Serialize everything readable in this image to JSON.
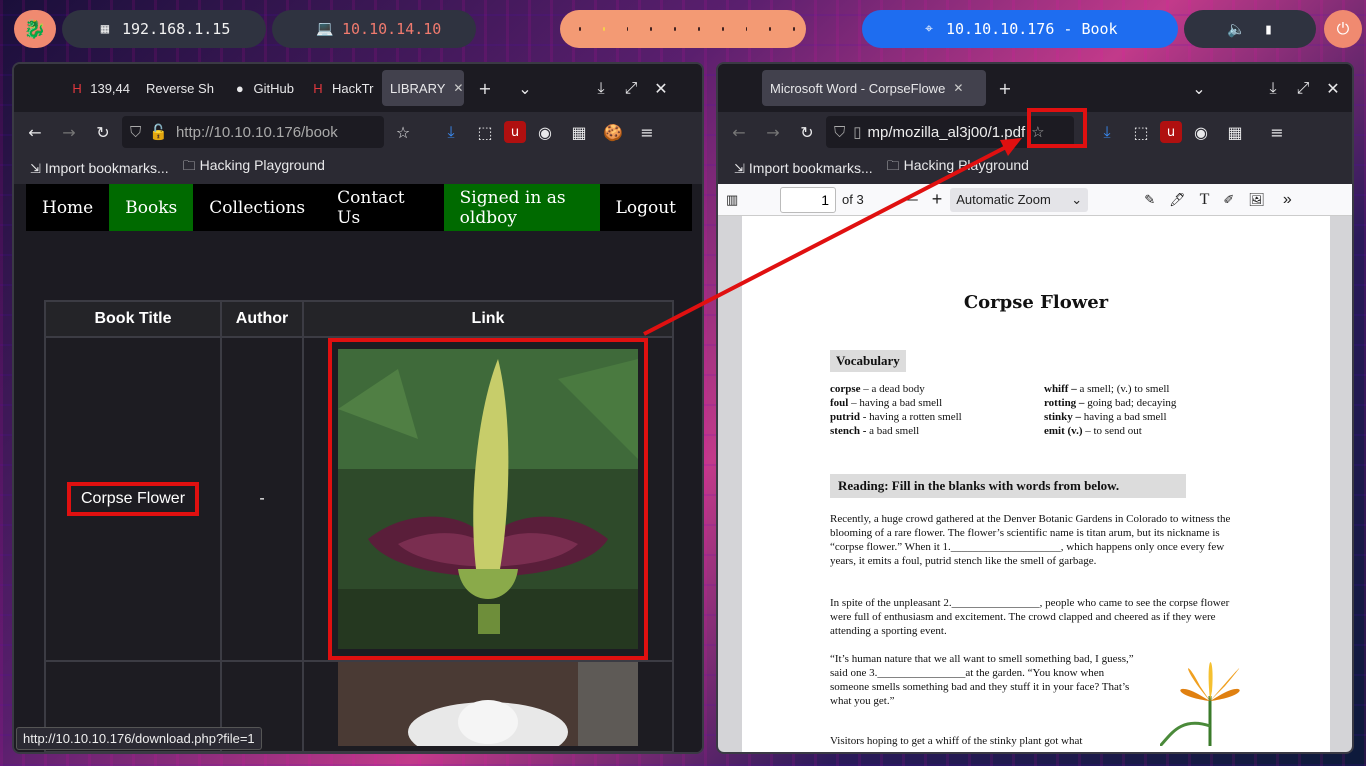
{
  "panel": {
    "ip_local": "192.168.1.15",
    "ip_vpn": "10.10.14.10",
    "target": "10.10.10.176 - Book"
  },
  "left_window": {
    "tabs": [
      {
        "label": "139,44"
      },
      {
        "label": "Reverse Sh"
      },
      {
        "label": "GitHub"
      },
      {
        "label": "HackTr"
      },
      {
        "label": "LIBRARY"
      }
    ],
    "url": "http://10.10.10.176/book",
    "bookmarks": [
      "Import bookmarks...",
      "Hacking Playground"
    ],
    "site_nav": [
      "Home",
      "Books",
      "Collections",
      "Contact Us",
      "Signed in as oldboy",
      "Logout"
    ],
    "table": {
      "headers": [
        "Book Title",
        "Author",
        "Link"
      ],
      "rows": [
        {
          "title": "Corpse Flower",
          "author": "-"
        }
      ]
    },
    "status_url": "http://10.10.10.176/download.php?file=1"
  },
  "right_window": {
    "tab_title": "Microsoft Word - CorpseFlowe",
    "url": "mp/mozilla_al3j00/1.pdf",
    "bookmarks": [
      "Import bookmarks...",
      "Hacking Playground"
    ],
    "pdf_toolbar": {
      "page": "1",
      "of": "of 3",
      "zoom": "Automatic Zoom"
    },
    "doc": {
      "title": "Corpse Flower",
      "vocab_heading": "Vocabulary",
      "vocab_left": [
        {
          "term": "corpse",
          "def": " – a dead body"
        },
        {
          "term": "foul",
          "def": " – having a bad smell"
        },
        {
          "term": "putrid",
          "def": " - having a rotten smell"
        },
        {
          "term": "stench -",
          "def": " a bad smell"
        }
      ],
      "vocab_right": [
        {
          "term": "whiff –",
          "def": " a smell; (v.) to smell"
        },
        {
          "term": "rotting –",
          "def": " going bad; decaying"
        },
        {
          "term": "stinky –",
          "def": " having a bad smell"
        },
        {
          "term": "emit (v.)",
          "def": " – to send out"
        }
      ],
      "reading_heading": "Reading: Fill in the blanks with words from below.",
      "p1": "Recently, a huge crowd gathered at the Denver Botanic Gardens in Colorado to witness the blooming of a rare flower.   The flower’s scientific name is titan arum, but its nickname is “corpse flower.”  When it 1.____________________, which happens only once every few years, it emits a foul, putrid stench like the smell of garbage.",
      "p2": "In spite of the unpleasant  2.________________, people who came to see the corpse flower were full of enthusiasm and excitement.  The crowd clapped and cheered as if they were attending a sporting event.",
      "p3": "“It’s human nature that we all want to smell something bad, I guess,” said one 3.________________at the garden. “You know when someone smells something bad and they stuff it in your face? That’s what you get.”",
      "p4": "Visitors hoping to get a whiff of the stinky plant got what"
    }
  }
}
